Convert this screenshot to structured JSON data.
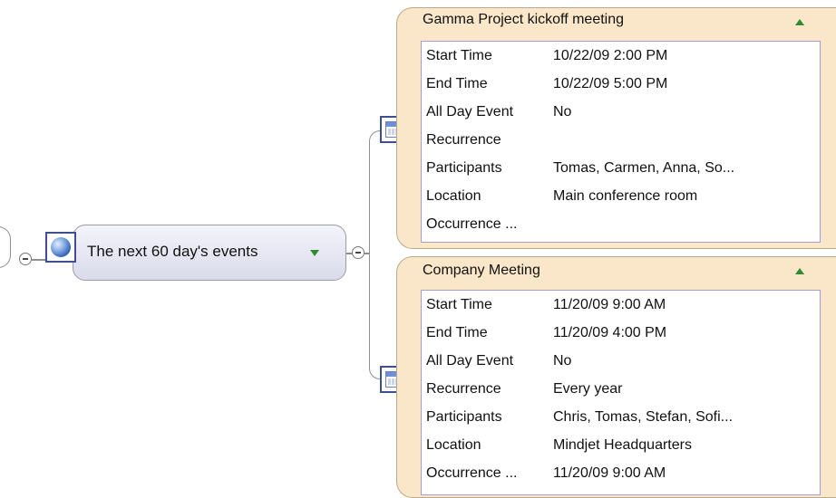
{
  "central_topic": {
    "label": "The next 60 day's events",
    "icon": "globe-icon"
  },
  "events": [
    {
      "title": "Gamma Project kickoff meeting",
      "rows": [
        {
          "key": "Start Time",
          "value": "10/22/09 2:00 PM"
        },
        {
          "key": "End Time",
          "value": "10/22/09 5:00 PM"
        },
        {
          "key": "All Day Event",
          "value": "No"
        },
        {
          "key": "Recurrence",
          "value": ""
        },
        {
          "key": "Participants",
          "value": "Tomas,  Carmen, Anna,  So..."
        },
        {
          "key": "Location",
          "value": "Main conference room"
        },
        {
          "key": "Occurrence ...",
          "value": ""
        }
      ]
    },
    {
      "title": "Company Meeting",
      "rows": [
        {
          "key": "Start Time",
          "value": "11/20/09 9:00 AM"
        },
        {
          "key": "End Time",
          "value": "11/20/09 4:00 PM"
        },
        {
          "key": "All Day Event",
          "value": "No"
        },
        {
          "key": "Recurrence",
          "value": "Every year"
        },
        {
          "key": "Participants",
          "value": " Chris, Tomas, Stefan,  Sofi..."
        },
        {
          "key": "Location",
          "value": "Mindjet Headquarters"
        },
        {
          "key": "Occurrence ...",
          "value": "11/20/09 9:00 AM"
        }
      ]
    }
  ],
  "colors": {
    "card_bg": "#fae7c9",
    "table_border": "#a79ad6",
    "expand_triangle": "#2e8b2e"
  }
}
